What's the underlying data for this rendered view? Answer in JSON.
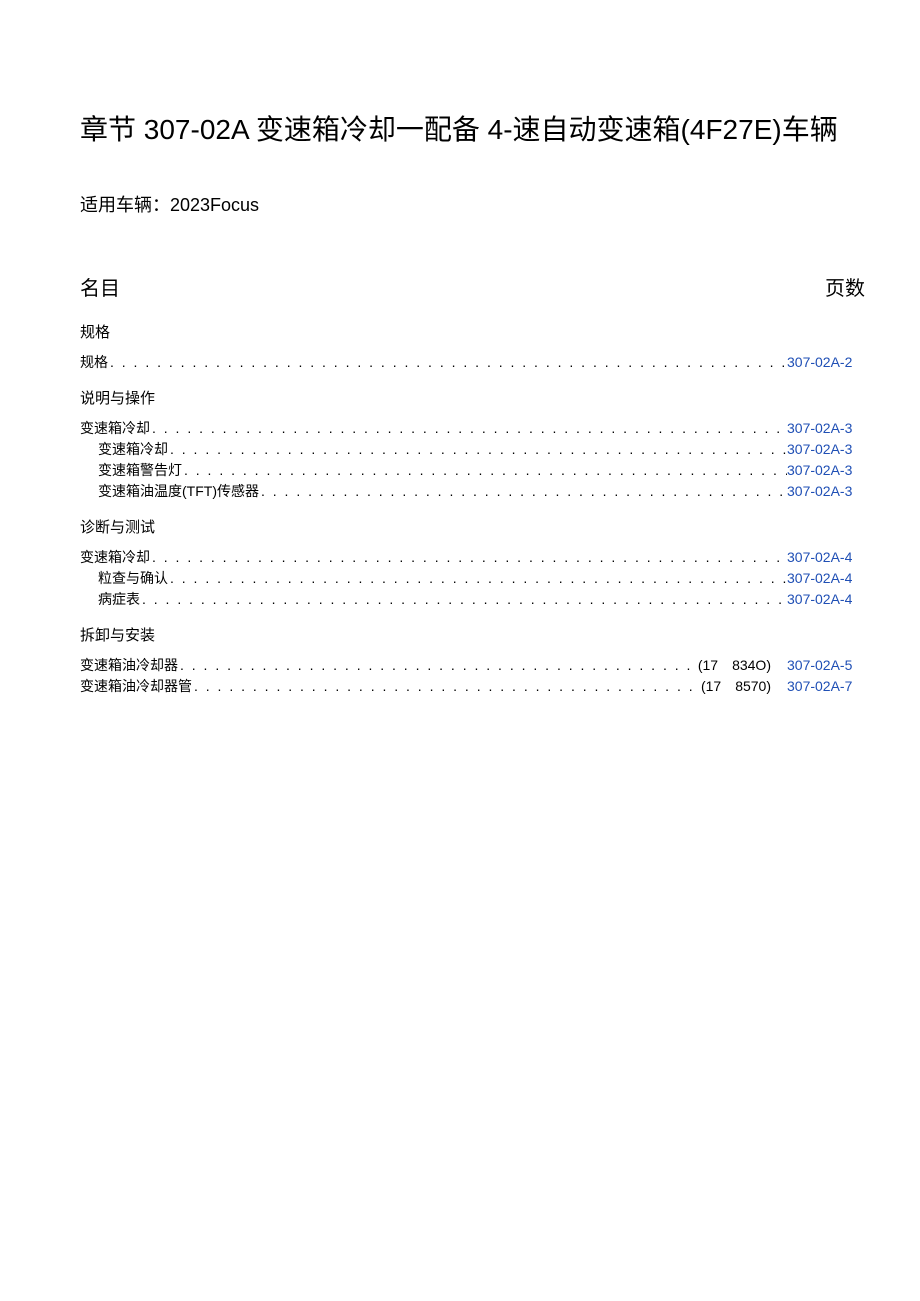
{
  "title": "章节 307-02A 变速箱冷却一配备 4-速自动变速箱(4F27E)车辆",
  "subtitle": "适用车辆：2023Focus",
  "toc_header_left": "名目",
  "toc_header_right": "页数",
  "sections": [
    {
      "heading": "规格",
      "items": [
        {
          "label": "规格",
          "indent": 0,
          "code": "",
          "page": "307-02A-2"
        }
      ]
    },
    {
      "heading": "说明与操作",
      "items": [
        {
          "label": "变速箱冷却",
          "indent": 0,
          "code": "",
          "page": "307-02A-3"
        },
        {
          "label": "变速箱冷却",
          "indent": 1,
          "code": "",
          "page": "307-02A-3"
        },
        {
          "label": "变速箱警告灯",
          "indent": 1,
          "code": "",
          "page": "307-02A-3"
        },
        {
          "label": "变速箱油温度(TFT)传感器",
          "indent": 1,
          "code": "",
          "page": "307-02A-3"
        }
      ]
    },
    {
      "heading": "诊断与测试",
      "items": [
        {
          "label": "变速箱冷却",
          "indent": 0,
          "code": "",
          "page": "307-02A-4"
        },
        {
          "label": "粒查与确认",
          "indent": 1,
          "code": "",
          "page": "307-02A-4"
        },
        {
          "label": "病症表",
          "indent": 1,
          "code": "",
          "page": "307-02A-4"
        }
      ]
    },
    {
      "heading": "拆卸与安装",
      "items": [
        {
          "label": "变速箱油冷却器",
          "indent": 0,
          "code": "(17 834O)",
          "page": "307-02A-5"
        },
        {
          "label": "变速箱油冷却器管",
          "indent": 0,
          "code": "(17 8570)",
          "page": "307-02A-7"
        }
      ]
    }
  ]
}
